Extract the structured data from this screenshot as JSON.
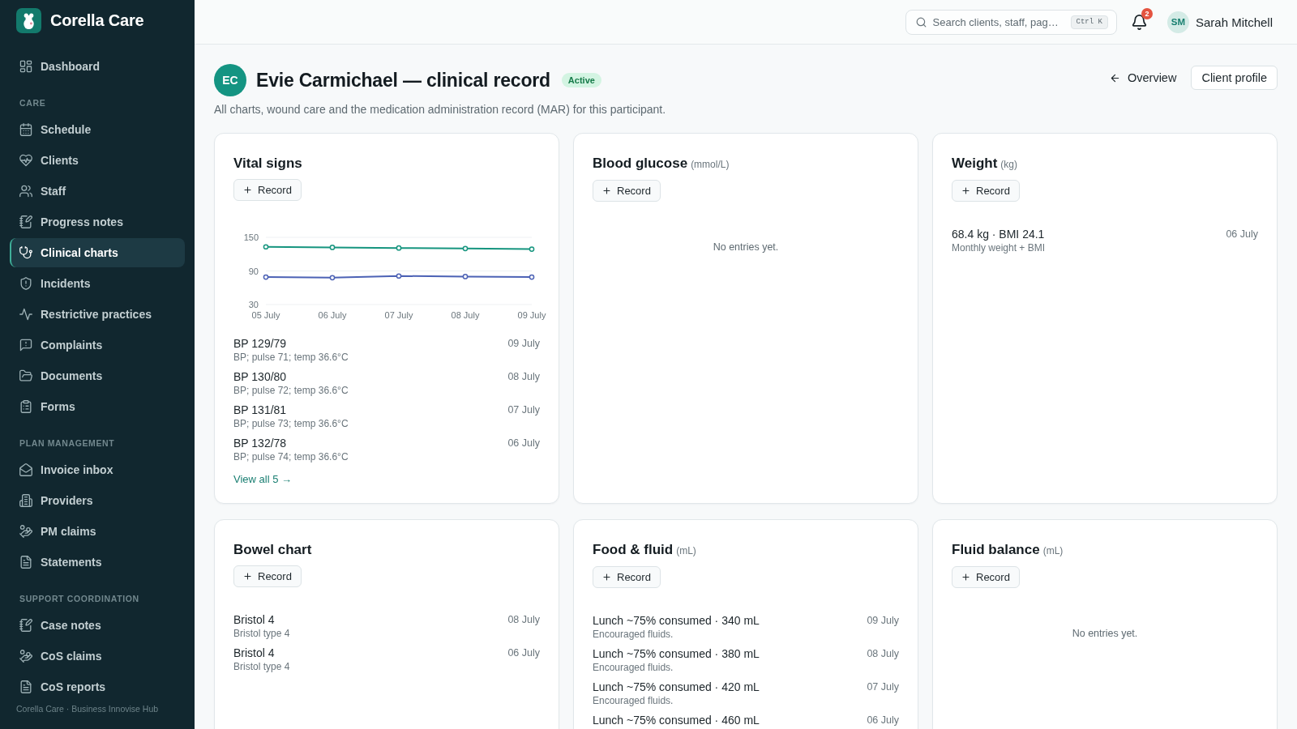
{
  "sidebar": {
    "brand": "Corella Care",
    "groups": [
      {
        "items": [
          {
            "label": "Dashboard",
            "selected": false
          }
        ]
      },
      {
        "heading": "CARE",
        "items": [
          {
            "label": "Schedule",
            "selected": false
          },
          {
            "label": "Clients",
            "selected": false
          },
          {
            "label": "Staff",
            "selected": false
          },
          {
            "label": "Progress notes",
            "selected": false
          },
          {
            "label": "Clinical charts",
            "selected": true
          },
          {
            "label": "Incidents",
            "selected": false
          },
          {
            "label": "Restrictive practices",
            "selected": false
          },
          {
            "label": "Complaints",
            "selected": false
          },
          {
            "label": "Documents",
            "selected": false
          },
          {
            "label": "Forms",
            "selected": false
          }
        ]
      },
      {
        "heading": "PLAN MANAGEMENT",
        "items": [
          {
            "label": "Invoice inbox",
            "selected": false
          },
          {
            "label": "Providers",
            "selected": false
          },
          {
            "label": "PM claims",
            "selected": false
          },
          {
            "label": "Statements",
            "selected": false
          }
        ]
      },
      {
        "heading": "SUPPORT COORDINATION",
        "items": [
          {
            "label": "Case notes",
            "selected": false
          },
          {
            "label": "CoS claims",
            "selected": false
          },
          {
            "label": "CoS reports",
            "selected": false
          }
        ]
      }
    ],
    "footer": "Corella Care · Business Innovise Hub"
  },
  "topbar": {
    "search": {
      "placeholder": "Search clients, staff, pag…",
      "shortcut": "Ctrl K"
    },
    "notifications": {
      "count": "2"
    },
    "user": {
      "initials": "SM",
      "name": "Sarah Mitchell"
    }
  },
  "client": {
    "initials": "EC",
    "title": "Evie Carmichael — clinical record",
    "status": "Active",
    "description": "All charts, wound care and the medication administration record (MAR) for this participant."
  },
  "actions": [
    {
      "kind": "back",
      "label": "Overview"
    },
    {
      "kind": "outline",
      "label": "Client profile"
    }
  ],
  "cards": [
    {
      "title": "Vital signs",
      "record": "Record",
      "chart_data": {
        "type": "line",
        "categories": [
          "05 July",
          "06 July",
          "07 July",
          "08 July",
          "09 July"
        ],
        "series": [
          {
            "color": "#16957f",
            "marker": "circle",
            "values": [
              133,
              132,
              131,
              130,
              129
            ]
          },
          {
            "color": "#4c62b5",
            "marker": "circle",
            "values": [
              79,
              78,
              81,
              80,
              79
            ]
          }
        ],
        "ylim": [
          30,
          150
        ],
        "yticks": [
          30,
          90,
          150
        ]
      },
      "entries": [
        {
          "title": "BP 129/79",
          "note": "BP; pulse 71; temp 36.6°C",
          "date": "09 July"
        },
        {
          "title": "BP 130/80",
          "note": "BP; pulse 72; temp 36.6°C",
          "date": "08 July"
        },
        {
          "title": "BP 131/81",
          "note": "BP; pulse 73; temp 36.6°C",
          "date": "07 July"
        },
        {
          "title": "BP 132/78",
          "note": "BP; pulse 74; temp 36.6°C",
          "date": "06 July"
        }
      ],
      "link": "View all 5 →"
    },
    {
      "title": "Blood glucose",
      "unit": "(mmol/L)",
      "record": "Record",
      "empty": "No entries yet."
    },
    {
      "title": "Weight",
      "unit": "(kg)",
      "record": "Record",
      "entries": [
        {
          "title": "68.4 kg · BMI 24.1",
          "note": "Monthly weight + BMI",
          "date": "06 July"
        }
      ]
    },
    {
      "title": "Bowel chart",
      "record": "Record",
      "entries": [
        {
          "title": "Bristol 4",
          "note": "Bristol type 4",
          "date": "08 July"
        },
        {
          "title": "Bristol 4",
          "note": "Bristol type 4",
          "date": "06 July"
        }
      ]
    },
    {
      "title": "Food & fluid",
      "unit": "(mL)",
      "record": "Record",
      "entries": [
        {
          "title": "Lunch ~75% consumed · 340 mL",
          "note": "Encouraged fluids.",
          "date": "09 July"
        },
        {
          "title": "Lunch ~75% consumed · 380 mL",
          "note": "Encouraged fluids.",
          "date": "08 July"
        },
        {
          "title": "Lunch ~75% consumed · 420 mL",
          "note": "Encouraged fluids.",
          "date": "07 July"
        },
        {
          "title": "Lunch ~75% consumed · 460 mL",
          "date": "06 July"
        }
      ]
    },
    {
      "title": "Fluid balance",
      "unit": "(mL)",
      "record": "Record",
      "empty": "No entries yet."
    }
  ]
}
